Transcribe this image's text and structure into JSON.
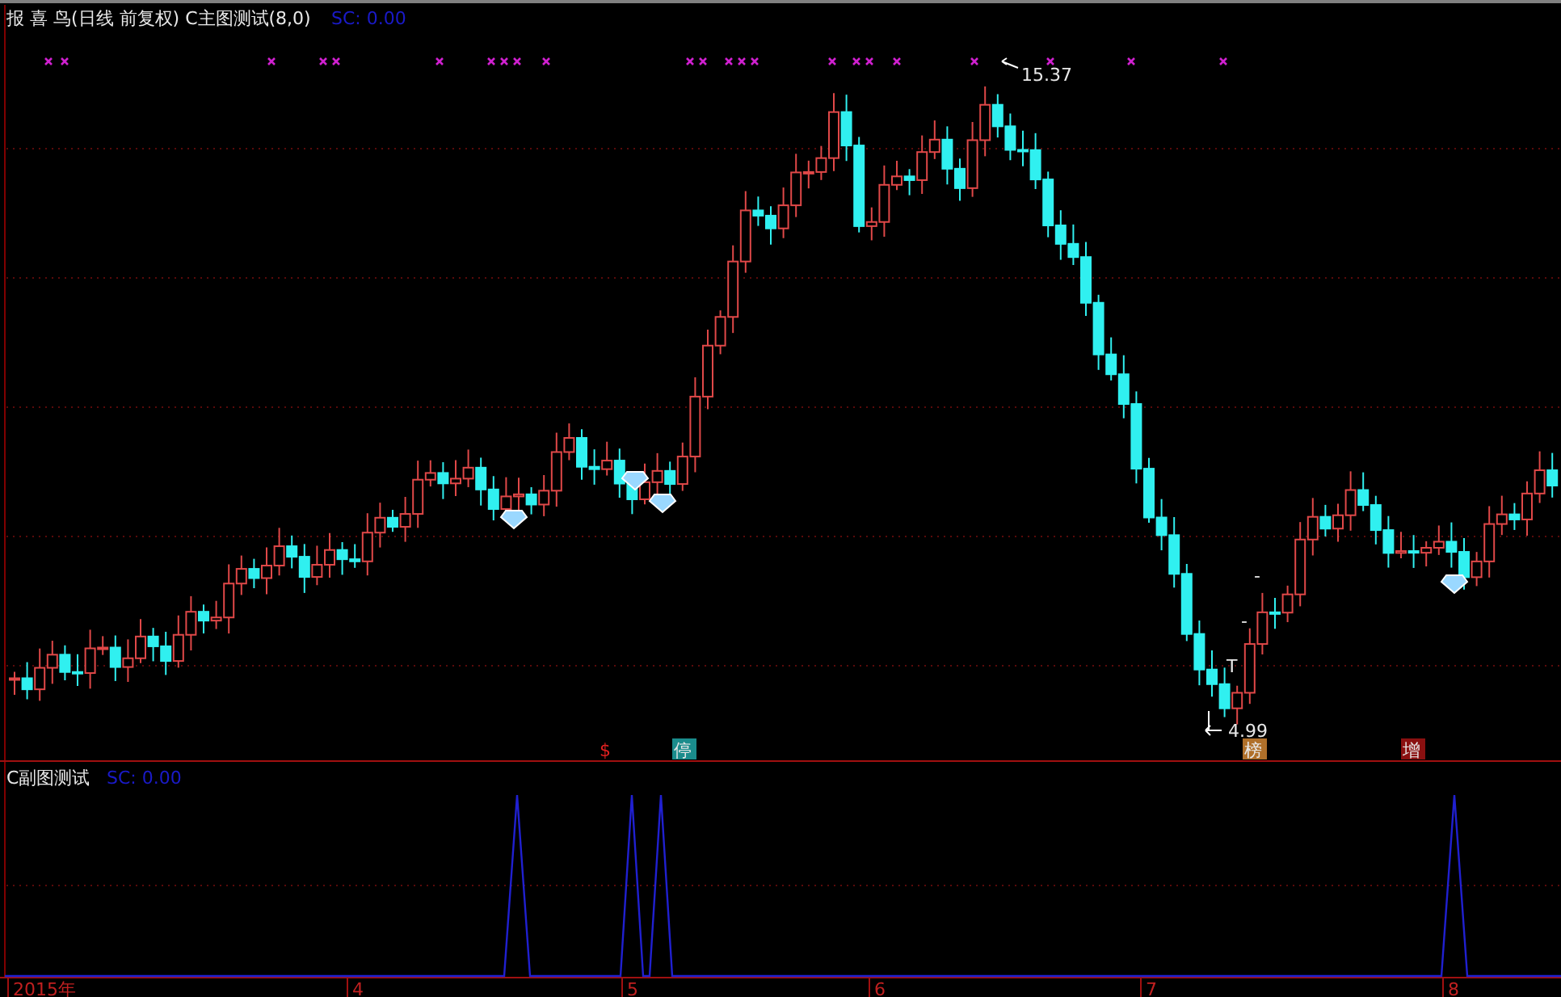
{
  "main_chart": {
    "title": "报 喜 鸟(日线 前复权) C主图测试(8,0)",
    "sc_label": "SC: 0.00",
    "annotations": [
      {
        "text": "15.37",
        "kind": "high"
      },
      {
        "text": "-",
        "kind": "plain"
      },
      {
        "text": "-",
        "kind": "plain"
      },
      {
        "text": "T",
        "kind": "plain"
      },
      {
        "text": "4.99",
        "kind": "low"
      }
    ],
    "signals": [
      {
        "text": "$",
        "kind": "plain",
        "color": "#e02020"
      },
      {
        "text": "停",
        "kind": "badge",
        "color": "#1a8c8c"
      },
      {
        "text": "榜",
        "kind": "badge",
        "color": "#b0702a"
      },
      {
        "text": "增",
        "kind": "badge",
        "color": "#8a1010"
      }
    ]
  },
  "sub_chart": {
    "title": "C副图测试",
    "sc_label": "SC: 0.00"
  },
  "time_axis": [
    "2015年",
    "4",
    "5",
    "6",
    "7",
    "8"
  ]
}
